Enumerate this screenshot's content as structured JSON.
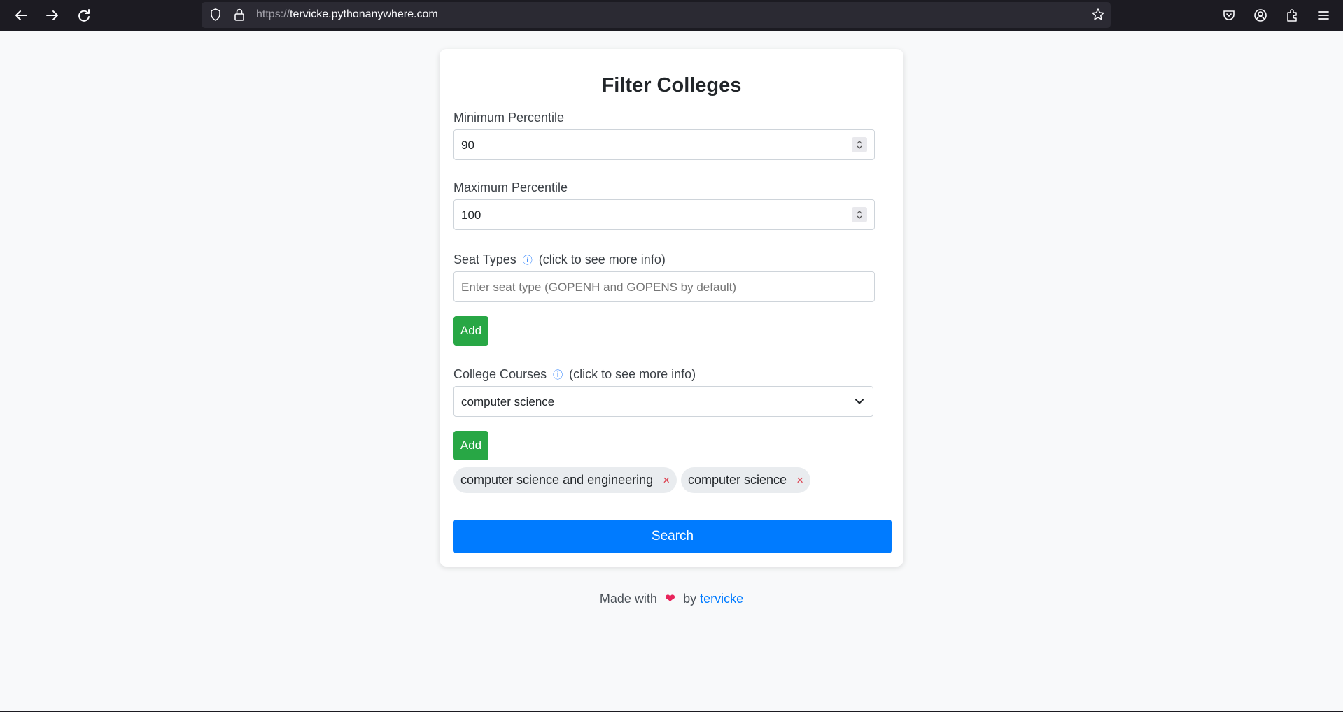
{
  "browser": {
    "url_scheme": "https://",
    "url_host": "tervicke.pythonanywhere.com"
  },
  "form": {
    "title": "Filter Colleges",
    "min_percentile": {
      "label": "Minimum Percentile",
      "value": "90"
    },
    "max_percentile": {
      "label": "Maximum Percentile",
      "value": "100"
    },
    "seat_types": {
      "label": "Seat Types",
      "info_icon": "info-circle-icon",
      "info_text": "(click to see more info)",
      "placeholder": "Enter seat type (GOPENH and GOPENS by default)",
      "add_label": "Add"
    },
    "college_courses": {
      "label": "College Courses",
      "info_icon": "info-circle-icon",
      "info_text": "(click to see more info)",
      "selected": "computer science",
      "add_label": "Add",
      "chips": [
        {
          "label": "computer science and engineering",
          "remove": "×"
        },
        {
          "label": "computer science",
          "remove": "×"
        }
      ]
    },
    "search_label": "Search"
  },
  "footer": {
    "made_with": "Made with",
    "heart": "❤",
    "by": "by",
    "author": "tervicke"
  },
  "colors": {
    "primary": "#007bff",
    "success": "#28a745",
    "danger": "#dc3545"
  }
}
